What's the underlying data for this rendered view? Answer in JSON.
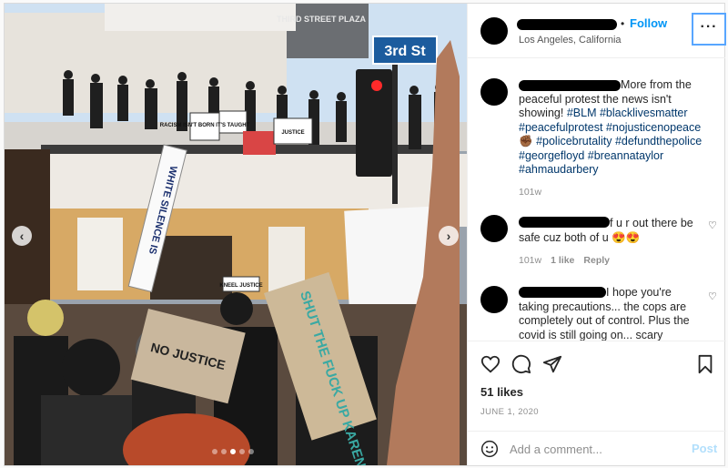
{
  "post": {
    "location": "Los Angeles, California",
    "follow_dot": "•",
    "follow_label": "Follow",
    "more_label": "···",
    "caption": {
      "text_start": "More from the peaceful protest the news isn't showing!",
      "hashtags": [
        "#BLM",
        "#blacklivesmatter",
        "#peacefulprotest",
        "#nojusticenopeace",
        "✊🏾",
        "#policebrutality",
        "#defundthepolice",
        "#georgefloyd",
        "#breannataylor",
        "#ahmaudarbery"
      ],
      "age": "101w"
    },
    "comments": [
      {
        "text": "f u r out there be safe cuz both of u 😍😍",
        "age": "101w",
        "likes": "1 like",
        "reply": "Reply",
        "heart": "♡"
      },
      {
        "text": "I hope you're taking precautions... the cops are completely out of control. Plus the covid is still going on... scary",
        "heart": "♡"
      }
    ],
    "likes": "51 likes",
    "date": "JUNE 1, 2020",
    "comment_placeholder": "Add a comment...",
    "post_label": "Post"
  },
  "photo": {
    "street_sign": "3rd St",
    "building_sign": "THIRD STREET PLAZA",
    "signs": [
      "RACISM ISN'T BORN IT'S TAUGHT",
      "JUSTICE",
      "KNEEL JUSTICE",
      "NO JUSTICE",
      "SHUT THE FUCK UP KAREN",
      "WHITE SILENCE IS"
    ],
    "prev": "‹",
    "next": "›",
    "dot_count": 5,
    "active_dot": 2
  },
  "colors": {
    "link": "#00376b",
    "follow": "#0095f6",
    "post_disabled": "#b2dffc",
    "highlight": "#58a6ff"
  }
}
